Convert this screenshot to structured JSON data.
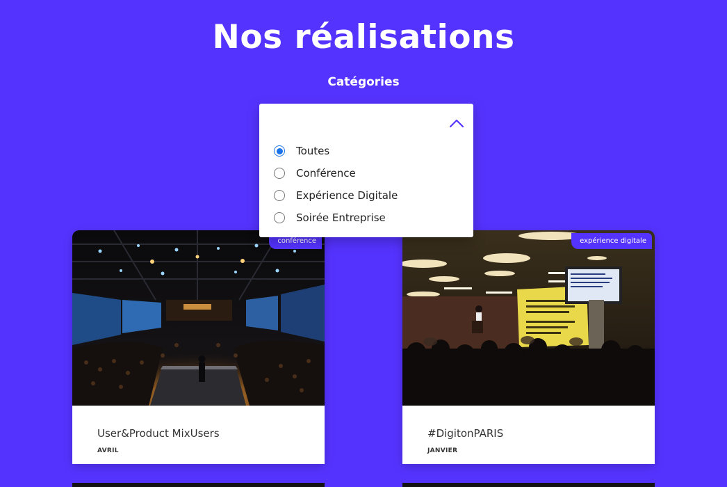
{
  "header": {
    "title": "Nos réalisations",
    "categories_label": "Catégories"
  },
  "filter": {
    "options": [
      {
        "label": "Toutes",
        "checked": true
      },
      {
        "label": "Conférence",
        "checked": false
      },
      {
        "label": "Expérience Digitale",
        "checked": false
      },
      {
        "label": "Soirée Entreprise",
        "checked": false
      }
    ]
  },
  "cards": [
    {
      "badge": "conférence",
      "title": "User&Product MixUsers",
      "date": "AVRIL"
    },
    {
      "badge": "expérience digitale",
      "title": "#DigitonPARIS",
      "date": "JANVIER"
    }
  ],
  "colors": {
    "brand": "#5533ff",
    "radio_checked": "#1a73e8",
    "card_bg": "#ffffff"
  }
}
